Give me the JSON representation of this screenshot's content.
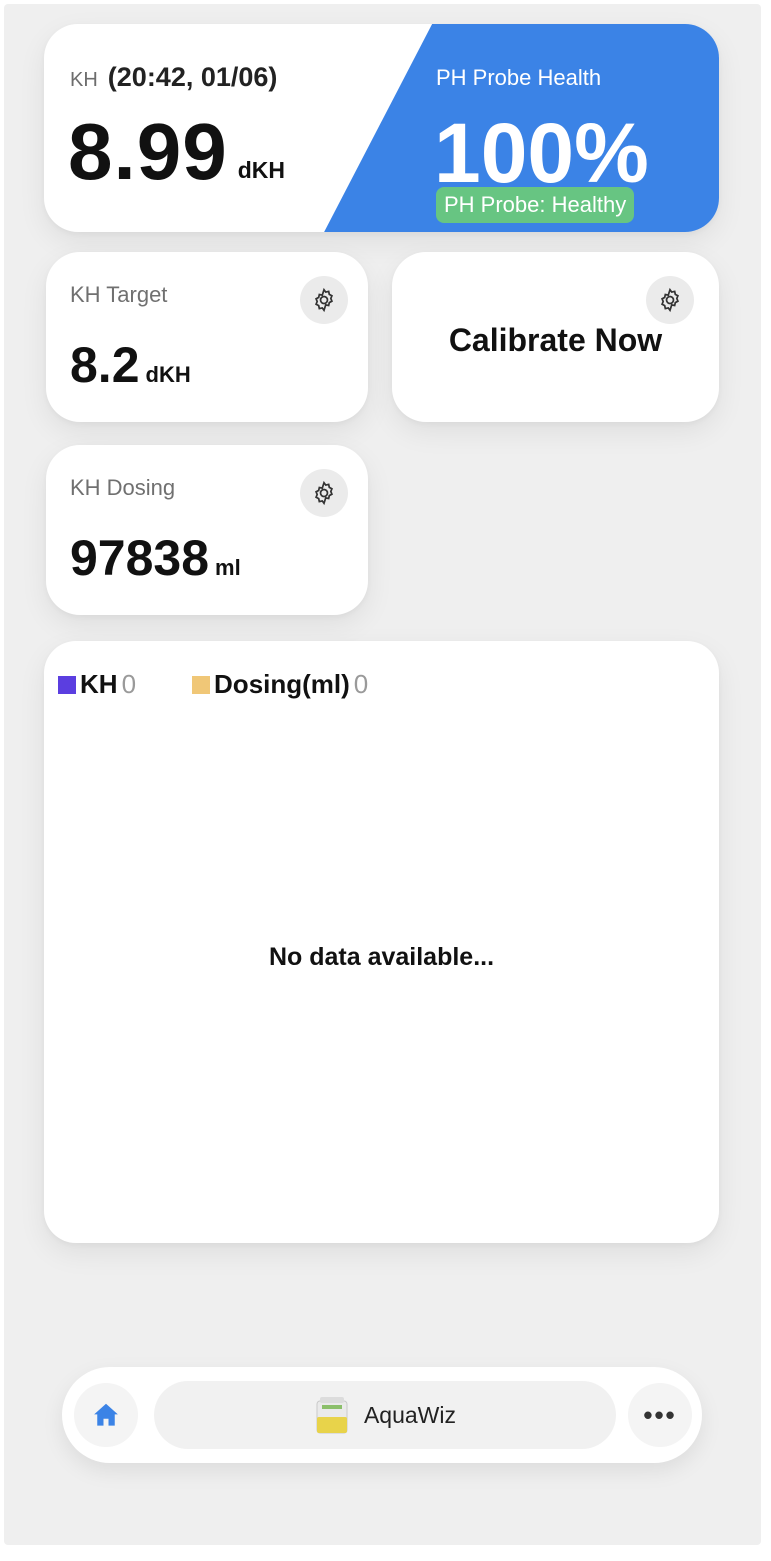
{
  "kh": {
    "label": "KH",
    "timestamp": "(20:42, 01/06)",
    "value": "8.99",
    "unit": "dKH"
  },
  "probe": {
    "title": "PH Probe Health",
    "value": "100%",
    "status": "PH Probe: Healthy"
  },
  "target": {
    "title": "KH Target",
    "value": "8.2",
    "unit": "dKH"
  },
  "calibrate": {
    "label": "Calibrate Now"
  },
  "dosing": {
    "title": "KH Dosing",
    "value": "97838",
    "unit": "ml"
  },
  "chart": {
    "legend": [
      {
        "name": "KH",
        "value": "0",
        "color": "#5b3ee0"
      },
      {
        "name": "Dosing(ml)",
        "value": "0",
        "color": "#f0c777"
      }
    ],
    "empty_message": "No data available..."
  },
  "nav": {
    "home_icon": "home-icon",
    "app_name": "AquaWiz",
    "more_icon": "more-icon"
  },
  "colors": {
    "accent_blue": "#3b83e6",
    "healthy_green": "#67c582"
  }
}
